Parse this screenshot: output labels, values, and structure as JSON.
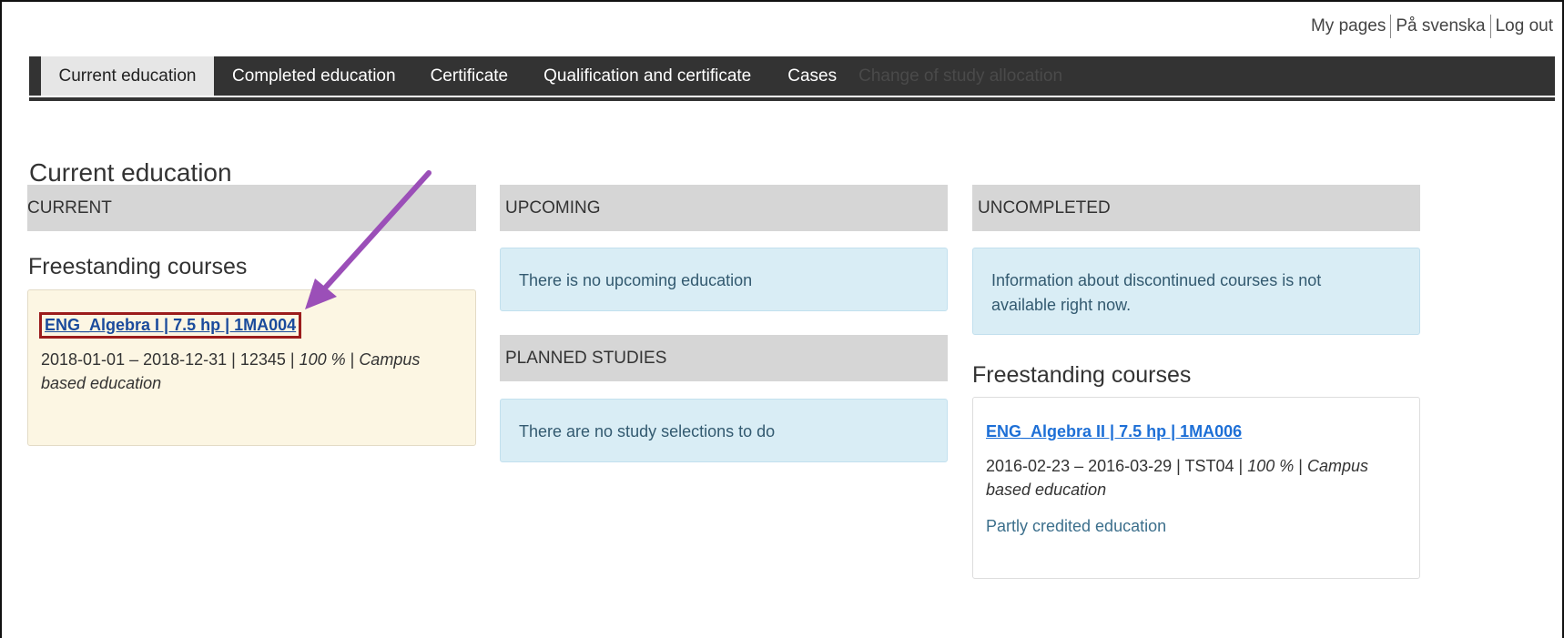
{
  "top_links": {
    "my_pages": "My pages",
    "swedish": "På svenska",
    "logout": "Log out"
  },
  "nav": {
    "tabs": [
      {
        "label": "Current education",
        "active": true
      },
      {
        "label": "Completed education"
      },
      {
        "label": "Certificate"
      },
      {
        "label": "Qualification and certificate"
      },
      {
        "label": "Cases"
      },
      {
        "label": "Change of study allocation"
      }
    ]
  },
  "page": {
    "title": "Current education"
  },
  "current": {
    "header": "CURRENT",
    "section": "Freestanding courses",
    "course": {
      "title": "ENG_Algebra I | 7.5 hp | 1MA004",
      "dates": "2018-01-01 – 2018-12-31 | 12345 | ",
      "pace": "100 %",
      "sep": " | ",
      "form": "Campus based education"
    }
  },
  "upcoming": {
    "header": "UPCOMING",
    "message": "There is no upcoming education",
    "planned_header": "PLANNED STUDIES",
    "planned_message": "There are no study selections to do"
  },
  "uncompleted": {
    "header": "UNCOMPLETED",
    "message": "Information about discontinued courses is not available right now.",
    "section": "Freestanding courses",
    "course": {
      "title": "ENG_Algebra II | 7.5 hp | 1MA006",
      "dates": "2016-02-23 – 2016-03-29 | TST04 | ",
      "pace": "100 %",
      "sep": " | ",
      "form": "Campus based education",
      "status": "Partly credited education"
    }
  },
  "annotation": {
    "arrow_color": "#9b4fb8",
    "highlight_color": "#9b1c1c"
  }
}
